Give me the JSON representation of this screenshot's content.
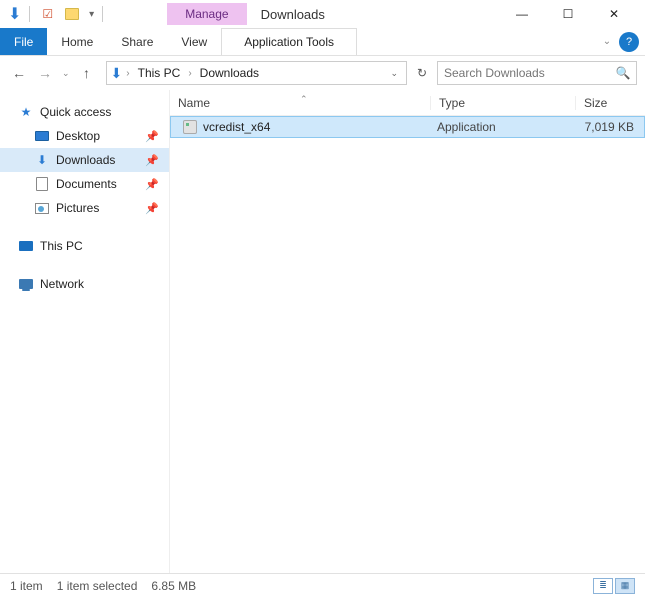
{
  "titlebar": {
    "context_tab": "Manage",
    "window_title": "Downloads"
  },
  "ribbon": {
    "file": "File",
    "home": "Home",
    "share": "Share",
    "view": "View",
    "tool_tab": "Application Tools"
  },
  "breadcrumb": {
    "root": "This PC",
    "current": "Downloads"
  },
  "search": {
    "placeholder": "Search Downloads"
  },
  "sidebar": {
    "quick_access": "Quick access",
    "items": [
      {
        "label": "Desktop"
      },
      {
        "label": "Downloads"
      },
      {
        "label": "Documents"
      },
      {
        "label": "Pictures"
      }
    ],
    "this_pc": "This PC",
    "network": "Network"
  },
  "columns": {
    "name": "Name",
    "type": "Type",
    "size": "Size"
  },
  "rows": [
    {
      "name": "vcredist_x64",
      "type": "Application",
      "size": "7,019 KB"
    }
  ],
  "status": {
    "count": "1 item",
    "selection": "1 item selected",
    "size": "6.85 MB"
  }
}
